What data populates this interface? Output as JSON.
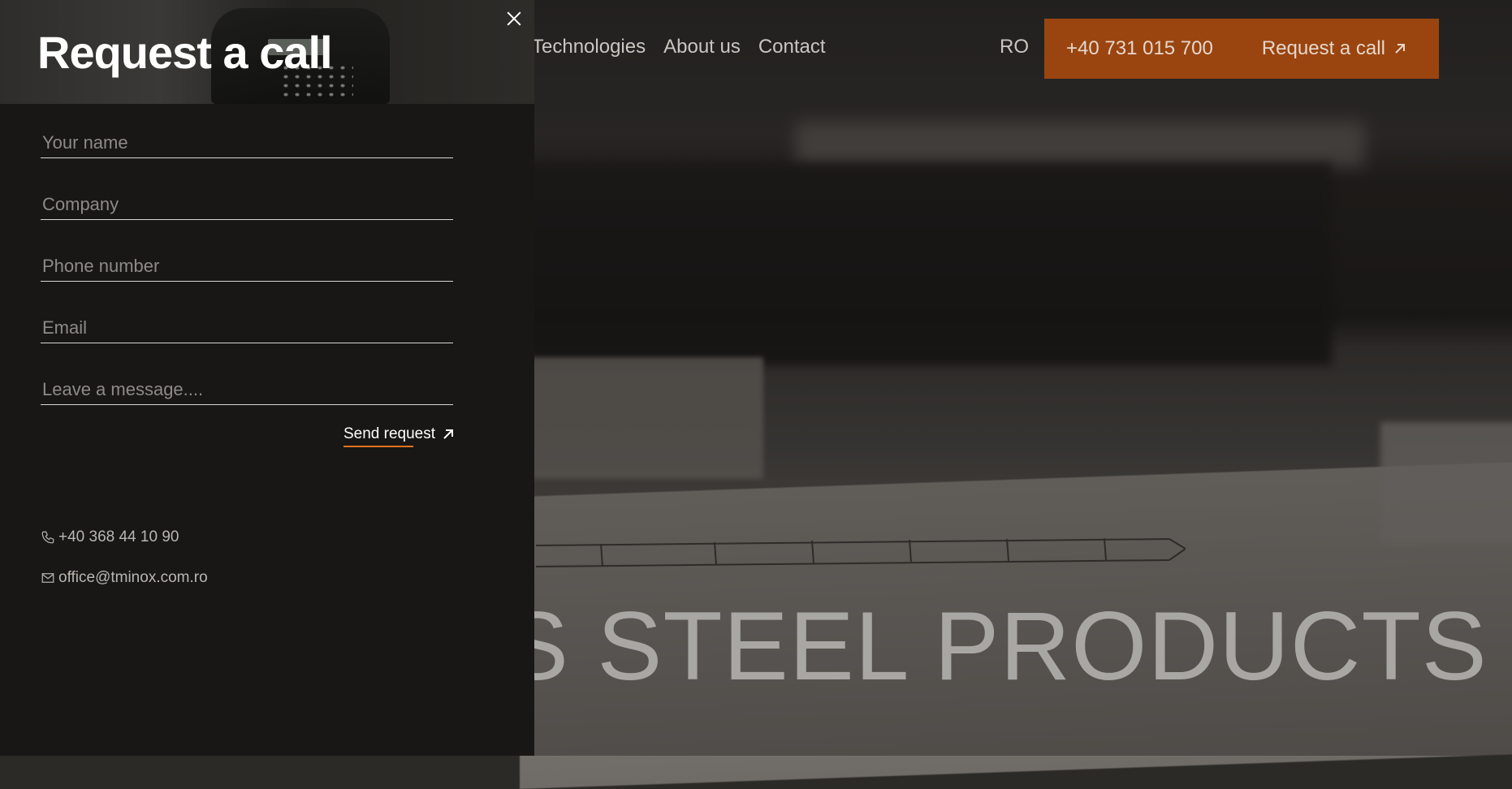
{
  "nav": {
    "items": [
      "Technologies",
      "About us",
      "Contact"
    ],
    "lang": "RO",
    "phone": "+40 731 015 700",
    "request_label": "Request a call"
  },
  "hero": {
    "title": "S STEEL PRODUCTS"
  },
  "panel": {
    "title": "Request a call",
    "fields": {
      "name": {
        "value": "",
        "placeholder": "Your name"
      },
      "company": {
        "value": "",
        "placeholder": "Company"
      },
      "phone": {
        "value": "",
        "placeholder": "Phone number"
      },
      "email": {
        "value": "",
        "placeholder": "Email"
      },
      "message": {
        "value": "",
        "placeholder": "Leave a message...."
      }
    },
    "send_label": "Send request",
    "contact_phone": "+40 368 44 10 90",
    "contact_email": "office@tminox.com.ro"
  },
  "colors": {
    "accent": "#9a450f",
    "underline": "#e2711d",
    "panel_bg": "#181715"
  },
  "icons": {
    "close": "close-icon",
    "arrow": "arrow-up-right-icon",
    "phone": "phone-icon",
    "mail": "mail-icon"
  }
}
